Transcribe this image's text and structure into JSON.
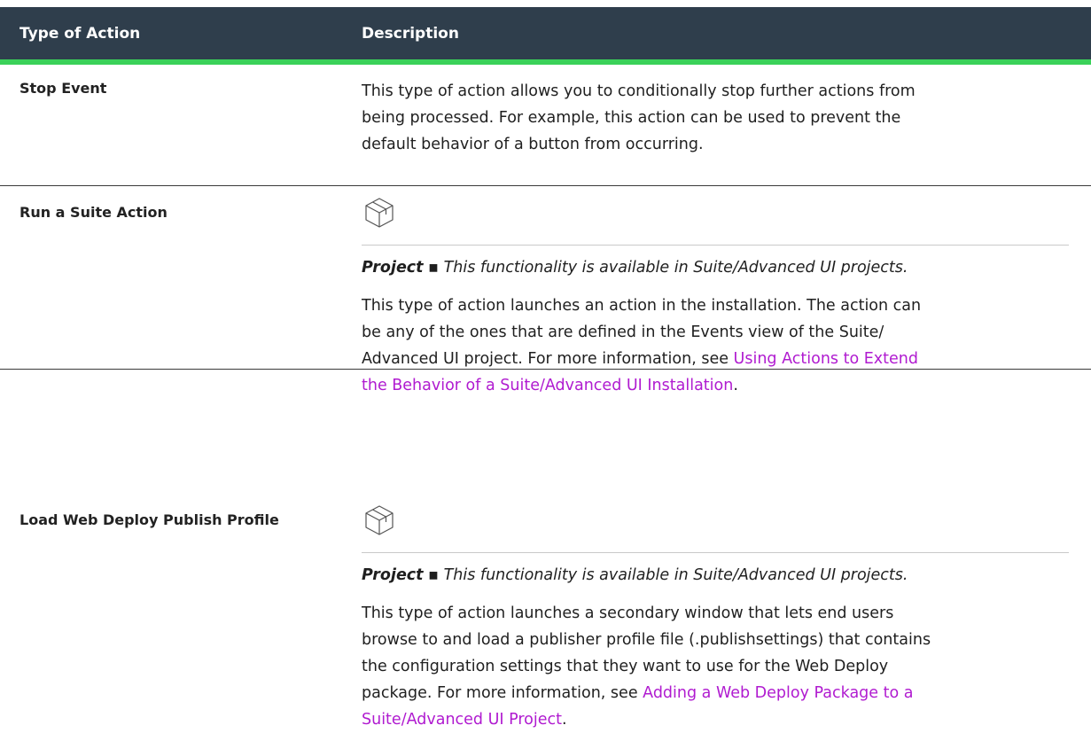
{
  "table": {
    "headers": [
      "Type of Action",
      "Description"
    ],
    "rows": [
      {
        "type": "Stop Event",
        "lines": [
          "This type of action allows you to conditionally stop further actions from",
          "being processed. For example, this action can be used to prevent the",
          "default behavior of a button from occurring."
        ]
      },
      {
        "type": "Run a Suite Action",
        "icon": "package-box-icon",
        "note_label": "Project",
        "note_bullet": "▪",
        "note_text": "This functionality is available in Suite/Advanced UI projects.",
        "line1": "This type of action launches an action in the installation. The action can",
        "line2": "be any of the ones that are defined in the Events view of the Suite/",
        "line3_pre": "Advanced UI project. For more information, see ",
        "link_part1": "Using Actions to Extend",
        "link_part2": "the Behavior of a Suite/Advanced UI Installation",
        "line4_post": "."
      },
      {
        "type": "Load Web Deploy Publish Profile",
        "icon": "package-box-icon",
        "note_label": "Project",
        "note_bullet": "▪",
        "note_text": "This functionality is available in Suite/Advanced UI projects.",
        "line1": "This type of action launches a secondary window that lets end users",
        "line2": "browse to and load a publisher profile file (.publishsettings) that contains",
        "line3": "the configuration settings that they want to use for the Web Deploy",
        "line4_pre": "package. For more information, see ",
        "link_part1": "Adding a Web Deploy Package to a",
        "link_part2": "Suite/Advanced UI Project",
        "line5_post": "."
      }
    ]
  },
  "colors": {
    "header_bg": "#2f3e4c",
    "header_accent": "#3ad159",
    "link": "#b01bd0"
  }
}
